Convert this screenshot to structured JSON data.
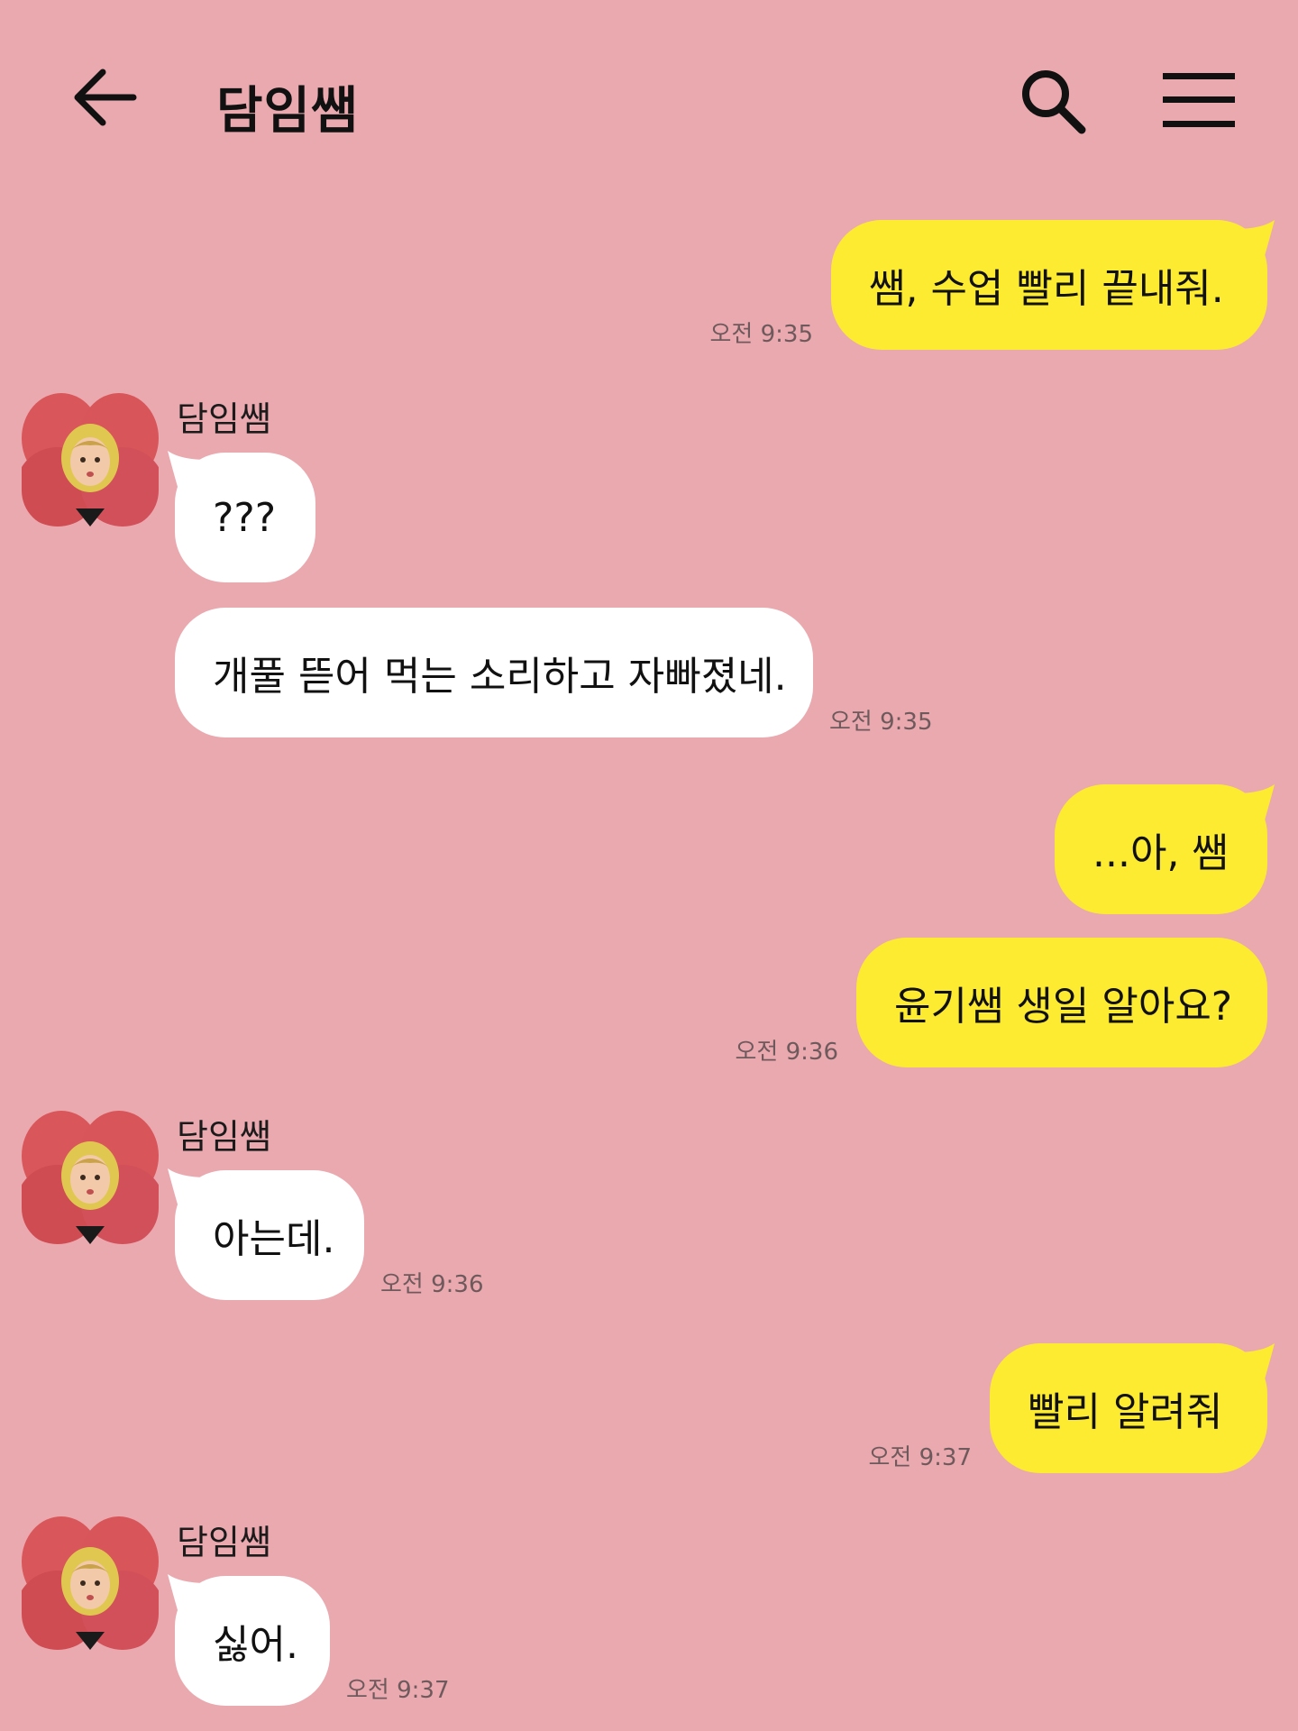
{
  "header": {
    "title": "담임쌤",
    "back_icon": "arrow-left-icon",
    "search_icon": "search-icon",
    "menu_icon": "hamburger-menu-icon"
  },
  "colors": {
    "background": "#eaa9af",
    "outgoing_bubble": "#fdeb32",
    "incoming_bubble": "#ffffff"
  },
  "messages": [
    {
      "direction": "outgoing",
      "text": "쌤, 수업 빨리 끝내줘.",
      "time": "오전 9:35"
    },
    {
      "direction": "incoming",
      "sender": "담임쌤",
      "text": "???"
    },
    {
      "direction": "incoming",
      "text": "개풀 뜯어 먹는 소리하고 자빠졌네.",
      "time": "오전 9:35"
    },
    {
      "direction": "outgoing",
      "text": "...아, 쌤"
    },
    {
      "direction": "outgoing",
      "text": "윤기쌤 생일 알아요?",
      "time": "오전 9:36"
    },
    {
      "direction": "incoming",
      "sender": "담임쌤",
      "text": "아는데.",
      "time": "오전 9:36"
    },
    {
      "direction": "outgoing",
      "text": "빨리 알려줘",
      "time": "오전 9:37"
    },
    {
      "direction": "incoming",
      "sender": "담임쌤",
      "text": "싫어.",
      "time": "오전 9:37"
    }
  ]
}
